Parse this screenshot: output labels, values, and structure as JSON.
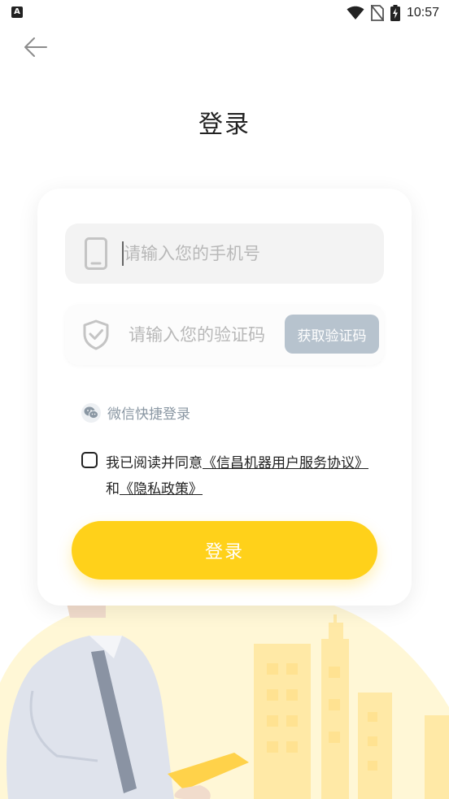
{
  "status_bar": {
    "left_icon_letter": "A",
    "left_icon": "notification-a-icon",
    "icons": [
      "wifi-icon",
      "no-sim-icon",
      "battery-charging-icon"
    ],
    "time": "10:57"
  },
  "header": {
    "back_icon": "arrow-left-icon",
    "title": "登录"
  },
  "form": {
    "phone": {
      "icon": "phone-icon",
      "placeholder": "请输入您的手机号",
      "value": ""
    },
    "code": {
      "icon": "shield-check-icon",
      "placeholder": "请输入您的验证码",
      "value": "",
      "get_code_label": "获取验证码"
    },
    "wechat_login": {
      "icon": "wechat-icon",
      "label": "微信快捷登录"
    },
    "agreement": {
      "checked": false,
      "prefix": "我已阅读并同意",
      "service_link": "《信昌机器用户服务协议》",
      "and": "和",
      "privacy_link": "《隐私政策》"
    },
    "submit_label": "登录"
  },
  "colors": {
    "accent": "#ffd11a",
    "code_button": "#b7c3ce",
    "placeholder": "#b8b8b8",
    "wechat_text": "#8a97a3"
  }
}
